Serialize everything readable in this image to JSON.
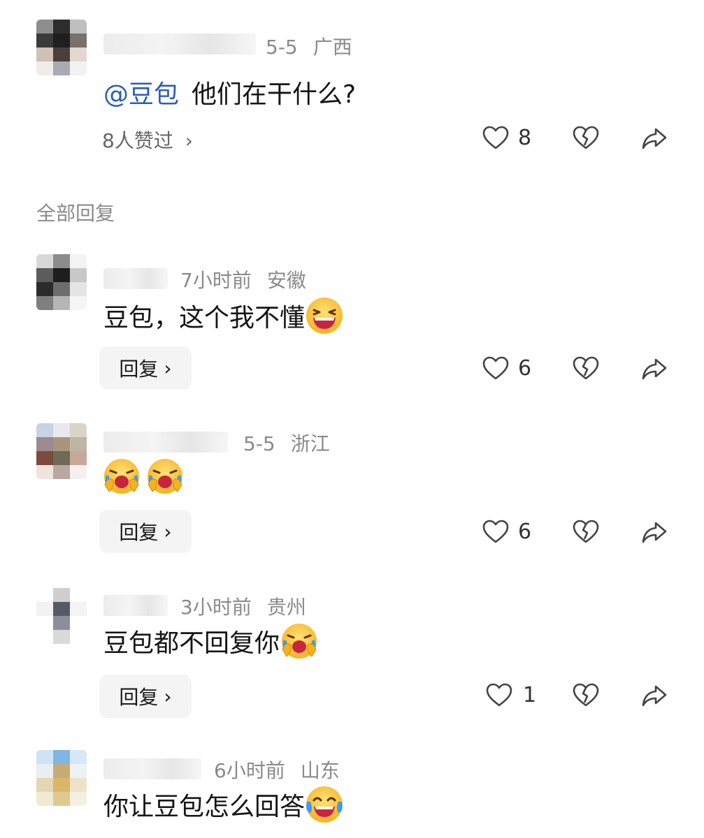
{
  "main_comment": {
    "time": "5-5",
    "location": "广西",
    "mention": "@豆包",
    "text": "他们在干什么?",
    "liked_by": "8人赞过",
    "likes": "8"
  },
  "section_title": "全部回复",
  "reply_label": "回复",
  "replies": [
    {
      "time": "7小时前",
      "location": "安徽",
      "text": "豆包，这个我不懂",
      "emoji": "laughing-face-icon",
      "likes": "6"
    },
    {
      "time": "5-5",
      "location": "浙江",
      "text": "",
      "emoji": "crying-face-icon",
      "likes": "6"
    },
    {
      "time": "3小时前",
      "location": "贵州",
      "text": "豆包都不回复你",
      "emoji": "crying-face-icon",
      "likes": "1"
    },
    {
      "time": "6小时前",
      "location": "山东",
      "text": "你让豆包怎么回答",
      "emoji": "tears-of-joy-icon",
      "likes": ""
    }
  ],
  "colors": {
    "mention": "#2a5dbb",
    "meta": "#8a8a8a",
    "reply_bg": "#f4f4f4"
  }
}
